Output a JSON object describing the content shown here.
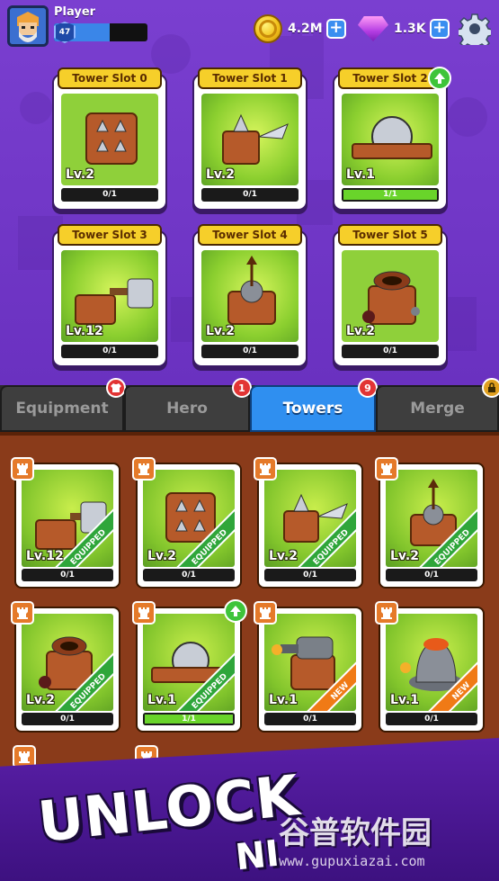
{
  "player": {
    "name": "Player",
    "level": "47",
    "xp_fraction": 0.6
  },
  "currency": {
    "coins": {
      "value": "4.2M"
    },
    "gems": {
      "value": "1.3K"
    }
  },
  "tower_slots": [
    {
      "title": "Tower Slot 0",
      "level": "Lv.2",
      "progress": "0/1",
      "fill": 0
    },
    {
      "title": "Tower Slot 1",
      "level": "Lv.2",
      "progress": "0/1",
      "fill": 0
    },
    {
      "title": "Tower Slot 2",
      "level": "Lv.1",
      "progress": "1/1",
      "fill": 1,
      "upgrade": true
    },
    {
      "title": "Tower Slot 3",
      "level": "Lv.12",
      "progress": "0/1",
      "fill": 0
    },
    {
      "title": "Tower Slot 4",
      "level": "Lv.2",
      "progress": "0/1",
      "fill": 0
    },
    {
      "title": "Tower Slot 5",
      "level": "Lv.2",
      "progress": "0/1",
      "fill": 0
    }
  ],
  "tabs": [
    {
      "label": "Equipment",
      "badge": ""
    },
    {
      "label": "Hero",
      "badge": "1"
    },
    {
      "label": "Towers",
      "badge": "9",
      "active": true
    },
    {
      "label": "Merge",
      "badge": ""
    }
  ],
  "tower_cards": [
    {
      "level": "Lv.12",
      "progress": "0/1",
      "tag": "EQUIPPED",
      "fill": 0
    },
    {
      "level": "Lv.2",
      "progress": "0/1",
      "tag": "EQUIPPED",
      "fill": 0
    },
    {
      "level": "Lv.2",
      "progress": "0/1",
      "tag": "EQUIPPED",
      "fill": 0
    },
    {
      "level": "Lv.2",
      "progress": "0/1",
      "tag": "EQUIPPED",
      "fill": 0
    },
    {
      "level": "Lv.2",
      "progress": "0/1",
      "tag": "EQUIPPED",
      "fill": 0
    },
    {
      "level": "Lv.1",
      "progress": "1/1",
      "tag": "EQUIPPED",
      "fill": 1,
      "upgrade": true
    },
    {
      "level": "Lv.1",
      "progress": "0/1",
      "tag": "NEW",
      "fill": 0
    },
    {
      "level": "Lv.1",
      "progress": "0/1",
      "tag": "NEW",
      "fill": 0
    }
  ],
  "banner": {
    "line1": "UNLOCK",
    "line2": "NI"
  },
  "watermark": {
    "cn": "谷普软件园",
    "url": "www.gupuxiazai.com"
  },
  "colors": {
    "accent": "#2f8ff0",
    "purple": "#6a31c0",
    "wood": "#8a3b1a",
    "gold": "#f6cf2a",
    "green": "#69d42a"
  }
}
